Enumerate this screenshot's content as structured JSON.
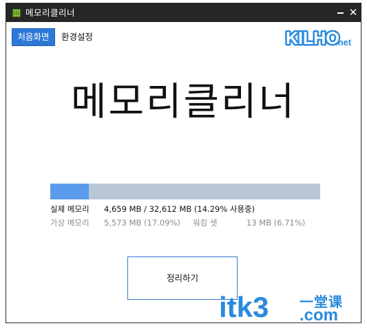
{
  "window": {
    "title": "메모리클리너",
    "icon": "memory-chip-icon",
    "controls": {
      "minimize_icon": "minimize-icon",
      "close_label": "✕",
      "close_icon": "close-icon"
    }
  },
  "nav": {
    "home_label": "처음화면",
    "settings_label": "환경설정"
  },
  "logo": {
    "main": "KILHO",
    "suffix": ".net",
    "brand_color": "#2a8bdc"
  },
  "hero_title": "메모리클리너",
  "memory": {
    "usage_fraction": 0.1429,
    "physical_label": "실제 메모리",
    "physical_value": "4,659 MB / 32,612 MB (14.29% 사용중)",
    "virtual_label": "가상 메모리",
    "virtual_value": "5,573 MB (17.09%)",
    "working_set_label": "워킹 셋",
    "working_set_value": "13 MB (6.71%)"
  },
  "clean_button_label": "정리하기",
  "watermark": {
    "latin": "itk3",
    "cjk": "一堂课",
    "domain": ".com"
  },
  "colors": {
    "titlebar": "#262626",
    "accent": "#2e78d6",
    "progress_fill": "#5b9bec",
    "progress_track": "#b9c6d6"
  }
}
